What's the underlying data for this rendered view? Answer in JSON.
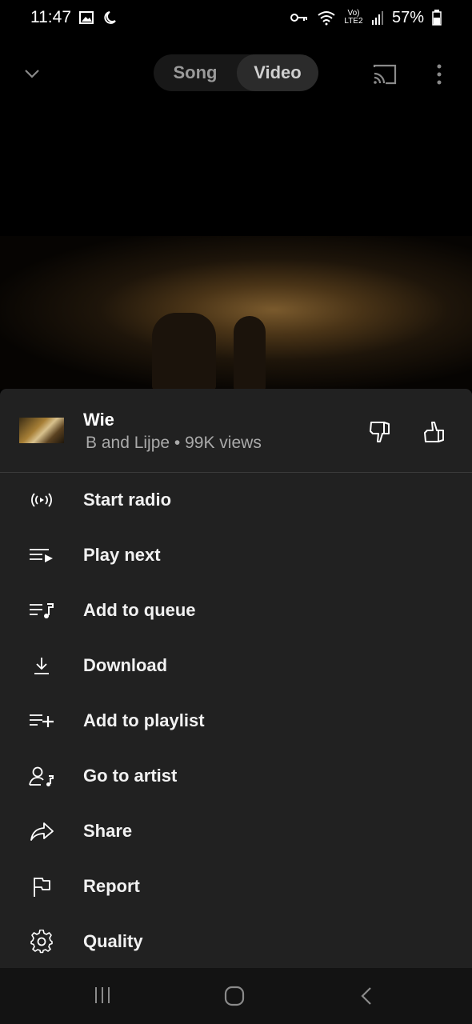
{
  "status_bar": {
    "time": "11:47",
    "battery": "57%",
    "icons": [
      "gallery-icon",
      "moon-icon",
      "key-icon",
      "wifi-icon",
      "volte-icon",
      "signal-icon",
      "battery-icon"
    ],
    "network_label": "Vo) LTE2"
  },
  "top_bar": {
    "tabs": [
      {
        "label": "Song",
        "selected": false
      },
      {
        "label": "Video",
        "selected": true
      }
    ],
    "icons": [
      "chevron-down-icon",
      "cast-icon",
      "more-vert-icon"
    ]
  },
  "track": {
    "title": "Wie",
    "subtitle": "B and Lijpe • 99K views"
  },
  "menu": {
    "items": [
      {
        "label": "Start radio",
        "icon": "radio-icon"
      },
      {
        "label": "Play next",
        "icon": "play-next-icon"
      },
      {
        "label": "Add to queue",
        "icon": "queue-music-icon"
      },
      {
        "label": "Download",
        "icon": "download-icon"
      },
      {
        "label": "Add to playlist",
        "icon": "playlist-add-icon"
      },
      {
        "label": "Go to artist",
        "icon": "artist-icon"
      },
      {
        "label": "Share",
        "icon": "share-icon"
      },
      {
        "label": "Report",
        "icon": "flag-icon"
      },
      {
        "label": "Quality",
        "icon": "gear-icon"
      }
    ]
  },
  "nav_bar": {
    "icons": [
      "recents-icon",
      "home-icon",
      "back-icon"
    ]
  },
  "colors": {
    "background": "#000000",
    "sheet": "#212121",
    "text_primary": "#ffffff",
    "text_secondary": "#aaaaaa"
  }
}
